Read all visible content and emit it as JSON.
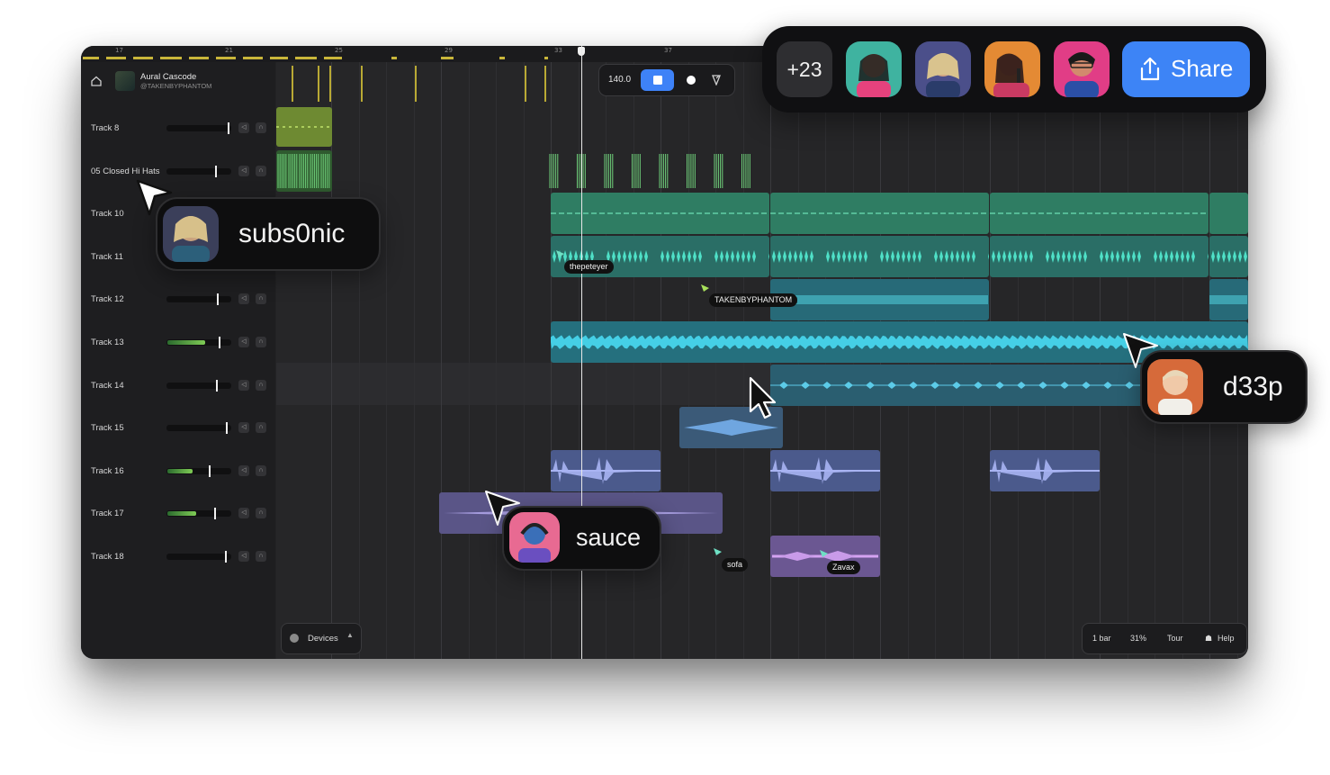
{
  "ruler": {
    "bars": [
      "17",
      "21",
      "25",
      "29",
      "33",
      "37"
    ]
  },
  "project": {
    "name": "Aural Cascode",
    "owner": "@TAKENBYPHANTOM"
  },
  "transport": {
    "bpm": "140.0"
  },
  "tracks": [
    {
      "name": "Track 8",
      "level": 0.0
    },
    {
      "name": "05 Closed Hi Hats",
      "level": 0.0
    },
    {
      "name": "Track 10",
      "level": null
    },
    {
      "name": "Track 11",
      "level": null
    },
    {
      "name": "Track 12",
      "level": 0.0
    },
    {
      "name": "Track 13",
      "level": 0.6
    },
    {
      "name": "Track 14",
      "level": 0.0
    },
    {
      "name": "Track 15",
      "level": 0.0
    },
    {
      "name": "Track 16",
      "level": 0.4
    },
    {
      "name": "Track 17",
      "level": 0.45
    },
    {
      "name": "Track 18",
      "level": 0.0
    }
  ],
  "clip_labels": {
    "thepeteyer": "thepeteyer",
    "takenbyphantom": "TAKENBYPHANTOM",
    "sofa": "sofa",
    "zavax": "Zavax"
  },
  "cursors": {
    "subs0nic": "subs0nic",
    "d33p": "d33p",
    "sauce": "sauce"
  },
  "bottom": {
    "devices": "Devices",
    "bar": "1 bar",
    "zoom": "31%",
    "tour": "Tour",
    "help": "Help"
  },
  "collab": {
    "count": "+23",
    "share": "Share"
  },
  "colors": {
    "accent": "#3d84f6",
    "green": "#4bbf8c",
    "cyan": "#2fb7c9",
    "lavender": "#8d8fd6",
    "purple": "#9a79c9",
    "lime": "#9ccf4a"
  }
}
